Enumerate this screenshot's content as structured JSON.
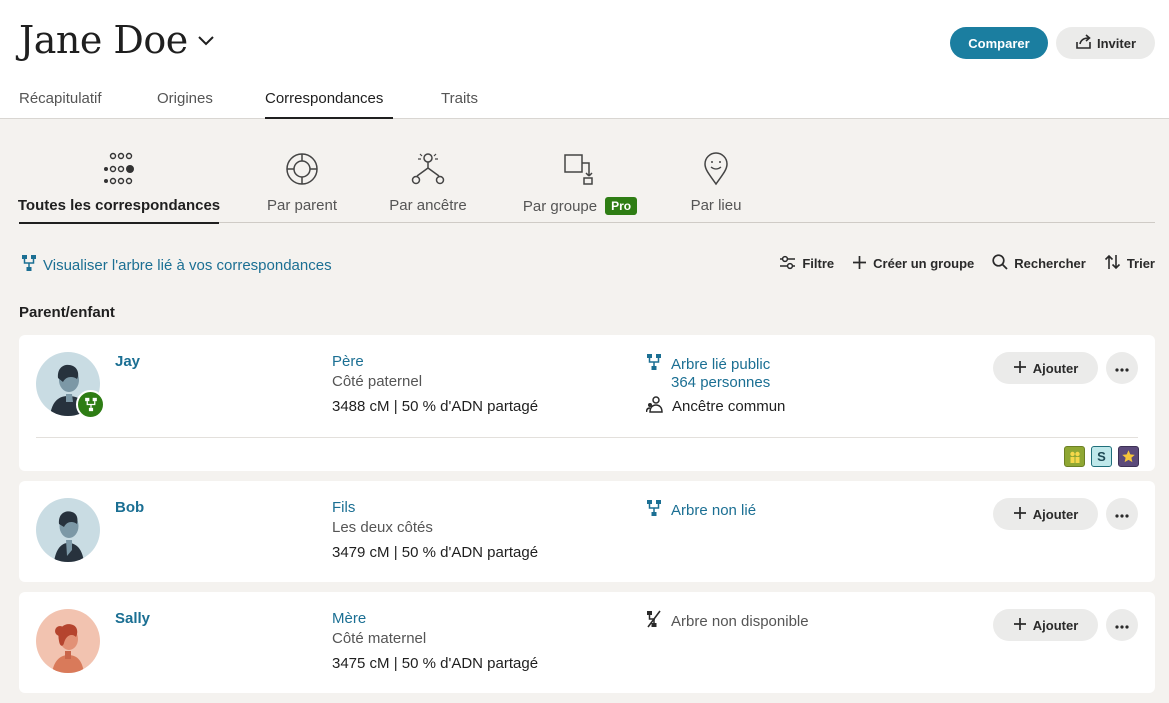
{
  "header": {
    "name": "Jane Doe",
    "compare_label": "Comparer",
    "invite_label": "Inviter",
    "tabs": [
      {
        "label": "Récapitulatif",
        "active": false
      },
      {
        "label": "Origines",
        "active": false
      },
      {
        "label": "Correspondances",
        "active": true
      },
      {
        "label": "Traits",
        "active": false
      }
    ]
  },
  "subtabs": [
    {
      "label": "Toutes les correspondances",
      "icon": "dots-cluster-icon",
      "active": true
    },
    {
      "label": "Par parent",
      "icon": "parent-circle-icon",
      "active": false
    },
    {
      "label": "Par ancêtre",
      "icon": "ancestor-branch-icon",
      "active": false
    },
    {
      "label": "Par groupe",
      "icon": "group-squares-icon",
      "active": false,
      "badge": "Pro"
    },
    {
      "label": "Par lieu",
      "icon": "location-pin-icon",
      "active": false
    }
  ],
  "tree_link": "Visualiser l'arbre lié à vos correspondances",
  "toolbar": {
    "filter": "Filtre",
    "create_group": "Créer un groupe",
    "search": "Rechercher",
    "sort": "Trier"
  },
  "section_title": "Parent/enfant",
  "add_label": "Ajouter",
  "matches": [
    {
      "name": "Jay",
      "relationship": "Père",
      "side": "Côté paternel",
      "dna": "3488 cM | 50 % d'ADN partagé",
      "tree_status": "Arbre lié public",
      "tree_persons": "364 personnes",
      "common_ancestor": "Ancêtre commun",
      "badges": [
        "family-badge-icon",
        "S",
        "star-badge-icon"
      ]
    },
    {
      "name": "Bob",
      "relationship": "Fils",
      "side": "Les deux côtés",
      "dna": "3479 cM | 50 % d'ADN partagé",
      "tree_status": "Arbre non lié"
    },
    {
      "name": "Sally",
      "relationship": "Mère",
      "side": "Côté maternel",
      "dna": "3475 cM | 50 % d'ADN partagé",
      "tree_status": "Arbre non disponible"
    }
  ],
  "colors": {
    "accent": "#1b7ea0",
    "link": "#1b6f93",
    "pro_badge": "#2e7d14",
    "background": "#f4f2ef"
  }
}
